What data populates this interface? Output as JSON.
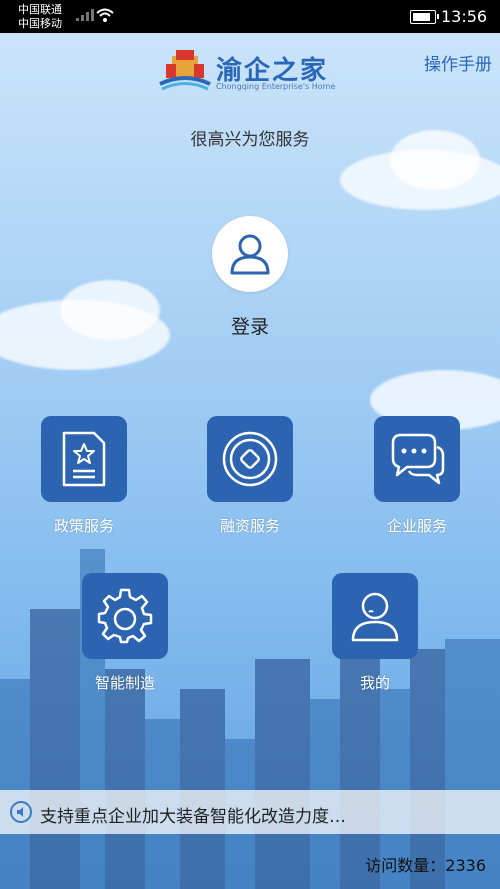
{
  "status_bar": {
    "carrier1": "中国联通",
    "carrier2": "中国移动",
    "time": "13:56",
    "battery_level": 0.85
  },
  "header": {
    "logo_title": "渝企之家",
    "logo_subtitle": "Chongqing Enterprise's Home",
    "manual_label": "操作手册"
  },
  "greeting": "很高兴为您服务",
  "login": {
    "label": "登录",
    "icon": "user-icon"
  },
  "tiles": [
    {
      "label": "政策服务",
      "icon": "policy-document-icon"
    },
    {
      "label": "融资服务",
      "icon": "coin-icon"
    },
    {
      "label": "企业服务",
      "icon": "chat-bubbles-icon"
    },
    {
      "label": "智能制造",
      "icon": "gear-icon"
    },
    {
      "label": "我的",
      "icon": "person-icon"
    }
  ],
  "ticker": {
    "text": "支持重点企业加大装备智能化改造力度…",
    "icon": "speaker-icon"
  },
  "visits": {
    "label": "访问数量：",
    "count": "2336"
  },
  "colors": {
    "accent": "#2c64b2",
    "title": "#2a67b8"
  }
}
